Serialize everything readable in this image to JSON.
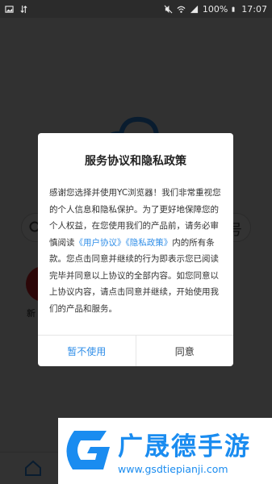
{
  "status_bar": {
    "battery": "100%",
    "time": "17:07",
    "icons": [
      "image-icon",
      "transfer-arrows-icon",
      "mute-icon",
      "wifi-icon",
      "signal-icon",
      "battery-icon"
    ]
  },
  "background": {
    "search_right_glyph": "号",
    "tile_label": "新"
  },
  "dialog": {
    "title": "服务协议和隐私政策",
    "body_part1": "感谢您选择并使用YC浏览器！我们非常重视您的个人信息和隐私保护。为了更好地保障您的个人权益，在您使用我们的产品前，请务必审慎阅读",
    "link_user_agreement": "《用户协议》",
    "link_privacy_policy": "《隐私政策》",
    "body_part2": "内的所有条款。您点击同意并继续的行为即表示您已阅读完毕并同意以上协议的全部内容。如您同意以上协议内容，请点击同意并继续，开始使用我们的产品和服务。",
    "decline_label": "暂不使用",
    "accept_label": "同意"
  },
  "watermark": {
    "title": "广晟德手游",
    "url": "www.gsdtiepianji.com"
  },
  "colors": {
    "link_blue": "#2f8ee8",
    "watermark_blue": "#1a8cf0",
    "overlay": "#2f2f2f"
  }
}
